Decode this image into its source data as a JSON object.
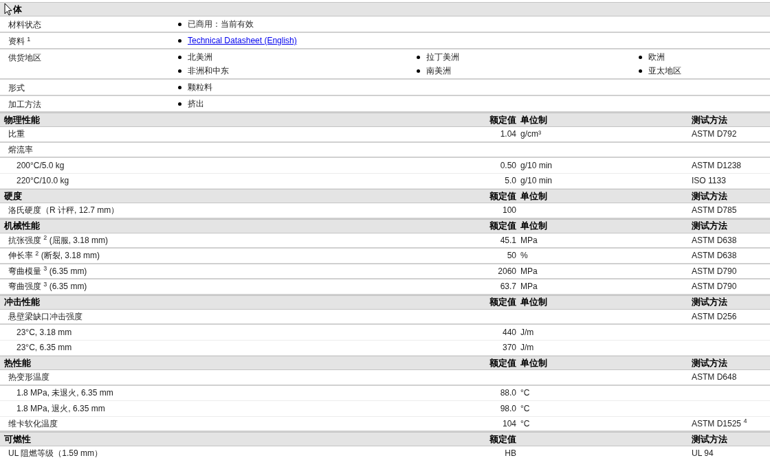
{
  "sections": [
    {
      "title": "体",
      "kind": "general",
      "rows": [
        {
          "label": "材料状态",
          "items": [
            {
              "text": "已商用：当前有效",
              "kind": "text"
            }
          ]
        },
        {
          "label": "资料 $^{1}$",
          "items": [
            {
              "text": "Technical Datasheet (English)",
              "kind": "link"
            }
          ]
        },
        {
          "label": "供货地区",
          "items": [
            {
              "text": "北美洲",
              "kind": "text"
            },
            {
              "text": "拉丁美洲",
              "kind": "text"
            },
            {
              "text": "欧洲",
              "kind": "text"
            },
            {
              "text": "非洲和中东",
              "kind": "text"
            },
            {
              "text": "南美洲",
              "kind": "text"
            },
            {
              "text": "亚太地区",
              "kind": "text"
            }
          ]
        },
        {
          "label": "形式",
          "items": [
            {
              "text": "颗粒料",
              "kind": "text"
            }
          ]
        },
        {
          "label": "加工方法",
          "items": [
            {
              "text": "挤出",
              "kind": "text"
            }
          ]
        }
      ]
    },
    {
      "title": "物理性能",
      "kind": "properties",
      "value_heading": "额定值",
      "unit_heading": "单位制",
      "method_heading": "测试方法",
      "rows": [
        {
          "label": "比重",
          "value": "1.04",
          "unit": "g/cm³",
          "method": "ASTM D792"
        },
        {
          "label": "熔流率",
          "children": [
            {
              "label": "200°C/5.0 kg",
              "value": "0.50",
              "unit": "g/10 min",
              "method": "ASTM D1238"
            },
            {
              "label": "220°C/10.0 kg",
              "value": "5.0",
              "unit": "g/10 min",
              "method": "ISO 1133"
            }
          ]
        }
      ]
    },
    {
      "title": "硬度",
      "kind": "properties",
      "value_heading": "额定值",
      "unit_heading": "单位制",
      "method_heading": "测试方法",
      "rows": [
        {
          "label": "洛氏硬度（R 计秤, 12.7 mm）",
          "value": "100",
          "method": "ASTM D785"
        }
      ]
    },
    {
      "title": "机械性能",
      "kind": "properties",
      "value_heading": "额定值",
      "unit_heading": "单位制",
      "method_heading": "测试方法",
      "rows": [
        {
          "label": "抗张强度 $^{2}$ (屈服, 3.18 mm)",
          "value": "45.1",
          "unit": "MPa",
          "method": "ASTM D638"
        },
        {
          "label": "伸长率 $^{2}$ (断裂, 3.18 mm)",
          "value": "50",
          "unit": "%",
          "method": "ASTM D638"
        },
        {
          "label": "弯曲模量 $^{3}$ (6.35 mm)",
          "value": "2060",
          "unit": "MPa",
          "method": "ASTM D790"
        },
        {
          "label": "弯曲强度 $^{3}$ (6.35 mm)",
          "value": "63.7",
          "unit": "MPa",
          "method": "ASTM D790"
        }
      ]
    },
    {
      "title": "冲击性能",
      "kind": "properties",
      "value_heading": "额定值",
      "unit_heading": "单位制",
      "method_heading": "测试方法",
      "rows": [
        {
          "label": "悬壁梁缺口冲击强度",
          "method": "ASTM D256",
          "children": [
            {
              "label": "23°C, 3.18 mm",
              "value": "440",
              "unit": "J/m"
            },
            {
              "label": "23°C, 6.35 mm",
              "value": "370",
              "unit": "J/m"
            }
          ]
        }
      ]
    },
    {
      "title": "热性能",
      "kind": "properties",
      "value_heading": "额定值",
      "unit_heading": "单位制",
      "method_heading": "测试方法",
      "rows": [
        {
          "label": "热变形温度",
          "method": "ASTM D648",
          "children": [
            {
              "label": "1.8 MPa, 未退火, 6.35 mm",
              "value": "88.0",
              "unit": "°C"
            },
            {
              "label": "1.8 MPa, 退火, 6.35 mm",
              "value": "98.0",
              "unit": "°C"
            }
          ]
        },
        {
          "label": "维卡软化温度",
          "value": "104",
          "unit": "°C",
          "method": "ASTM D1525 $^{4}$"
        }
      ]
    },
    {
      "title": "可燃性",
      "kind": "properties",
      "value_heading": "额定值",
      "method_heading": "测试方法",
      "rows": [
        {
          "label": "UL 阻燃等级（1.59 mm）",
          "value": "HB",
          "method": "UL 94"
        }
      ]
    }
  ]
}
